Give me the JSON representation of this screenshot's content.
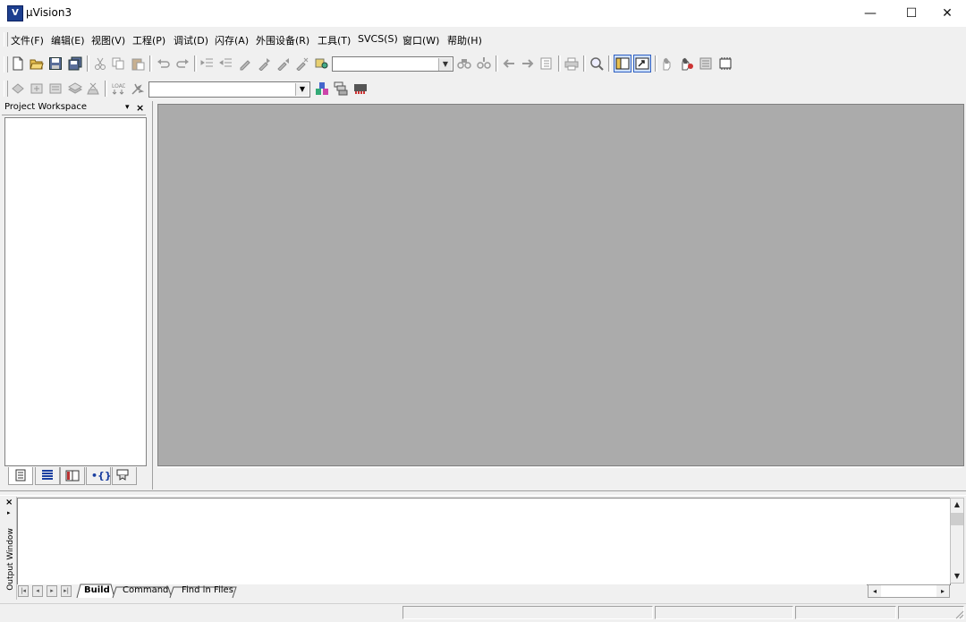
{
  "window": {
    "title": "µVision3",
    "minimize_symbol": "—",
    "maximize_symbol": "☐",
    "close_symbol": "✕"
  },
  "menu": {
    "file": "文件(F)",
    "edit": "编辑(E)",
    "view": "视图(V)",
    "project": "工程(P)",
    "debug": "调试(D)",
    "flash": "闪存(A)",
    "peripherals": "外围设备(R)",
    "tools": "工具(T)",
    "svcs": "SVCS(S)",
    "window": "窗口(W)",
    "help": "帮助(H)"
  },
  "toolbar1": {
    "icons": [
      "new-file-icon",
      "open-file-icon",
      "save-icon",
      "save-all-icon",
      "cut-icon",
      "copy-icon",
      "paste-icon",
      "undo-icon",
      "redo-icon",
      "indent-icon",
      "unindent-icon",
      "bookmark-icon",
      "next-bookmark-icon",
      "prev-bookmark-icon",
      "clear-bookmarks-icon",
      "find-in-files-icon",
      "find-icon",
      "incremental-find-icon",
      "back-icon",
      "forward-icon",
      "goto-icon",
      "print-icon",
      "zoom-icon",
      "workspace-toggle-icon",
      "output-toggle-icon",
      "hand-icon",
      "debug-hand-icon",
      "config-icon",
      "memory-icon"
    ],
    "find_combo_value": ""
  },
  "toolbar2": {
    "icons": [
      "translate-icon",
      "build-icon",
      "rebuild-icon",
      "batch-build-icon",
      "stop-build-icon",
      "download-icon",
      "options-icon",
      "target-options-icon",
      "manage-components-icon",
      "flash-icon"
    ],
    "target_combo_value": ""
  },
  "workspace": {
    "title": "Project Workspace",
    "pin_symbol": "▾",
    "close_symbol": "×",
    "tabs": [
      "files-tab-icon",
      "regs-tab-icon",
      "books-tab-icon",
      "functions-tab-icon",
      "templates-tab-icon"
    ]
  },
  "output": {
    "title": "Output Window",
    "close_symbol": "×",
    "tabs": [
      "Build",
      "Command",
      "Find in Files"
    ],
    "active_tab": "Build",
    "text": ""
  },
  "colors": {
    "chrome": "#f0f0f0",
    "mdi_background": "#ababab",
    "title_bar": "#ffffff"
  }
}
